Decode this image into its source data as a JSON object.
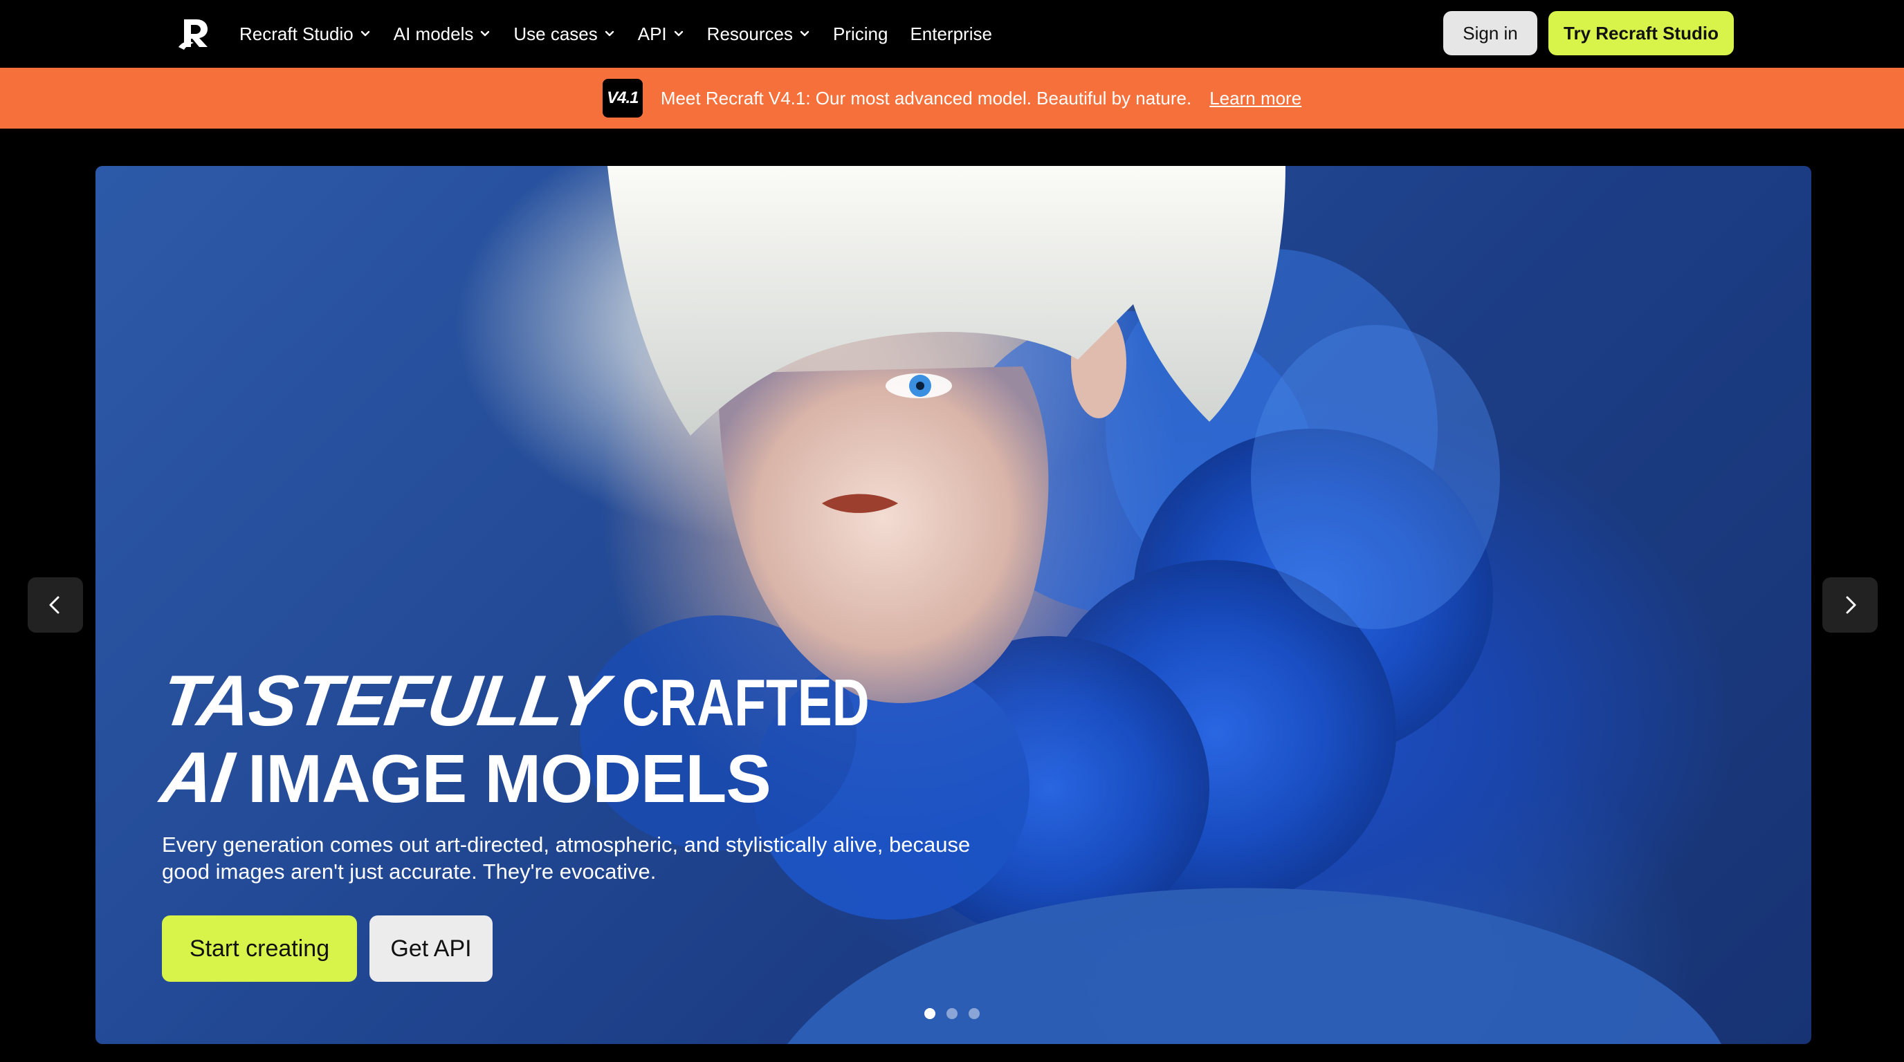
{
  "brand": {
    "name": "Recraft",
    "logo_icon": "recraft-r-logo-icon"
  },
  "nav": {
    "items": [
      {
        "label": "Recraft Studio",
        "has_dropdown": true
      },
      {
        "label": "AI models",
        "has_dropdown": true
      },
      {
        "label": "Use cases",
        "has_dropdown": true
      },
      {
        "label": "API",
        "has_dropdown": true
      },
      {
        "label": "Resources",
        "has_dropdown": true
      },
      {
        "label": "Pricing",
        "has_dropdown": false
      },
      {
        "label": "Enterprise",
        "has_dropdown": false
      }
    ],
    "signin_label": "Sign in",
    "try_label": "Try Recraft Studio"
  },
  "announcement": {
    "badge": "V4.1",
    "text": "Meet Recraft V4.1: Our most advanced model. Beautiful by nature.",
    "link_label": "Learn more"
  },
  "hero": {
    "title_line1_italic": "TASTEFULLY",
    "title_line1_rest": "CRAFTED",
    "title_line2_italic": "AI",
    "title_line2_rest": "IMAGE MODELS",
    "subtitle": "Every generation comes out art-directed, atmospheric, and stylistically alive, because good images aren't just accurate. They're evocative.",
    "primary_cta": "Start creating",
    "secondary_cta": "Get API",
    "slide_count": 3,
    "active_slide": 1
  },
  "colors": {
    "accent_lime": "#d8f34a",
    "banner_orange": "#f5703a",
    "background": "#000000",
    "hero_blue": "#1f53c9"
  },
  "icons": {
    "dropdown": "chevron-down-icon",
    "prev": "chevron-left-icon",
    "next": "chevron-right-icon"
  }
}
